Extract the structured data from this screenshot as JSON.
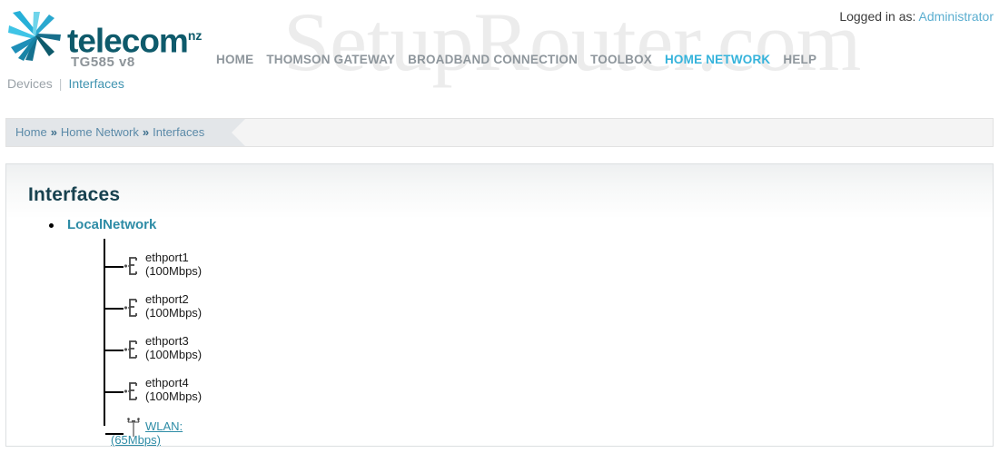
{
  "watermark": {
    "text": "SetupRouter.com"
  },
  "header": {
    "brand_name": "telecom",
    "brand_sup": "nz",
    "model": "TG585 v8",
    "logo_icon": "telecom-starburst-logo",
    "login": {
      "label": "Logged in as:",
      "user": "Administrator"
    },
    "mainnav": [
      {
        "label": "HOME",
        "active": false
      },
      {
        "label": "THOMSON GATEWAY",
        "active": false
      },
      {
        "label": "BROADBAND CONNECTION",
        "active": false
      },
      {
        "label": "TOOLBOX",
        "active": false
      },
      {
        "label": "HOME NETWORK",
        "active": true
      },
      {
        "label": "HELP",
        "active": false
      }
    ],
    "subnav": [
      {
        "label": "Devices",
        "active": false
      },
      {
        "label": "Interfaces",
        "active": true
      }
    ],
    "subnav_separator": "|"
  },
  "breadcrumb": {
    "items": [
      "Home",
      "Home Network",
      "Interfaces"
    ],
    "separator": "»"
  },
  "panel": {
    "title": "Interfaces",
    "tree": {
      "root": {
        "label": "LocalNetwork",
        "icon": "bullet-icon"
      },
      "children": [
        {
          "name": "ethport1",
          "speed": "(100Mbps)",
          "icon": "ethernet-port-icon",
          "link": false
        },
        {
          "name": "ethport2",
          "speed": "(100Mbps)",
          "icon": "ethernet-port-icon",
          "link": false
        },
        {
          "name": "ethport3",
          "speed": "(100Mbps)",
          "icon": "ethernet-port-icon",
          "link": false
        },
        {
          "name": "ethport4",
          "speed": "(100Mbps)",
          "icon": "ethernet-port-icon",
          "link": false
        },
        {
          "name": "WLAN:",
          "speed": "(65Mbps)",
          "icon": "wireless-antenna-icon",
          "link": true
        }
      ]
    }
  },
  "colors": {
    "accent_teal": "#2e8ca6",
    "nav_active": "#35b3db",
    "brand_dark": "#0e5a6b",
    "heading": "#17414f",
    "muted": "#8e969c"
  }
}
